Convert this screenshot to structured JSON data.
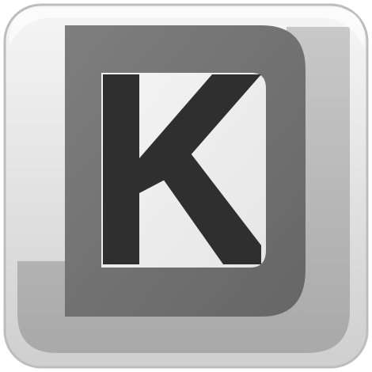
{
  "app_icon": {
    "name": "dkj-app-icon",
    "logo_letters": [
      "D",
      "J",
      "K"
    ],
    "colors": {
      "background": "#ffffff",
      "frame": "#d2d2d2",
      "frame_highlight": "#ececec",
      "j_shape": "#b9b9b9",
      "d_shape": "#737373",
      "inner_panel": "#ededed",
      "k_letter": "#2f2f2f"
    }
  }
}
